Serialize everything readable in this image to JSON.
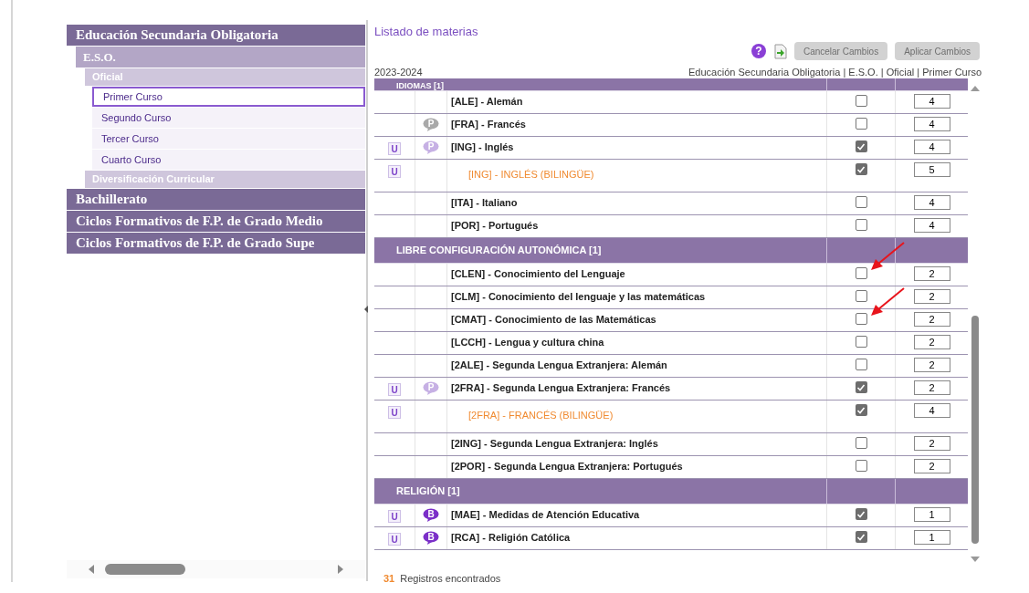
{
  "sidebar": {
    "items": [
      {
        "label": "Educación Secundaria Obligatoria",
        "children": [
          {
            "label": "E.S.O.",
            "children": [
              {
                "label": "Oficial",
                "children": [
                  {
                    "label": "Primer Curso",
                    "selected": true
                  },
                  {
                    "label": "Segundo Curso",
                    "selected": false
                  },
                  {
                    "label": "Tercer Curso",
                    "selected": false
                  },
                  {
                    "label": "Cuarto Curso",
                    "selected": false
                  }
                ]
              },
              {
                "label": "Diversificación Curricular"
              }
            ]
          }
        ]
      },
      {
        "label": "Bachillerato"
      },
      {
        "label": "Ciclos Formativos de F.P. de Grado Medio"
      },
      {
        "label": "Ciclos Formativos de F.P. de Grado Supe"
      }
    ]
  },
  "panel": {
    "title": "Listado de materias",
    "help": "?",
    "buttons": [
      {
        "label": "Cancelar Cambios",
        "disabled": true
      },
      {
        "label": "Aplicar Cambios",
        "disabled": true
      }
    ],
    "year": "2023-2024",
    "breadcrumb": "Educación Secundaria Obligatoria | E.S.O. | Oficial | Primer Curso"
  },
  "table": {
    "rows": [
      {
        "kind": "header",
        "label": "IDIOMAS [1]",
        "partial": true
      },
      {
        "kind": "subject",
        "label": "[ALE] - Alemán",
        "bilingual": false,
        "checked": false,
        "hours": "4"
      },
      {
        "kind": "subject",
        "badge": {
          "letter": "P",
          "color": "#a9a9a9"
        },
        "label": "[FRA] - Francés",
        "bilingual": false,
        "checked": false,
        "hours": "4"
      },
      {
        "kind": "subject",
        "tag": "U",
        "badge": {
          "letter": "P",
          "color": "#c6b0e4"
        },
        "label": "[ING] - Inglés",
        "bilingual": false,
        "checked": true,
        "hours": "4"
      },
      {
        "kind": "subject",
        "tag": "U",
        "label": "[ING] - INGLÉS (BILINGÜE)",
        "bilingual": true,
        "checked": true,
        "hours": "5"
      },
      {
        "kind": "subject",
        "label": "[ITA] - Italiano",
        "bilingual": false,
        "checked": false,
        "hours": "4"
      },
      {
        "kind": "subject",
        "label": "[POR] - Portugués",
        "bilingual": false,
        "checked": false,
        "hours": "4"
      },
      {
        "kind": "header",
        "label": "LIBRE CONFIGURACIÓN AUTONÓMICA [1]",
        "partial": false
      },
      {
        "kind": "subject",
        "label": "[CLEN] - Conocimiento del Lenguaje",
        "bilingual": false,
        "checked": false,
        "hours": "2",
        "arrow": true
      },
      {
        "kind": "subject",
        "label": "[CLM] - Conocimiento del lenguaje y las matemáticas",
        "bilingual": false,
        "checked": false,
        "hours": "2"
      },
      {
        "kind": "subject",
        "label": "[CMAT] - Conocimiento de las Matemáticas",
        "bilingual": false,
        "checked": false,
        "hours": "2",
        "arrow": true
      },
      {
        "kind": "subject",
        "label": "[LCCH] - Lengua y cultura china",
        "bilingual": false,
        "checked": false,
        "hours": "2"
      },
      {
        "kind": "subject",
        "label": "[2ALE] - Segunda Lengua Extranjera: Alemán",
        "bilingual": false,
        "checked": false,
        "hours": "2"
      },
      {
        "kind": "subject",
        "tag": "U",
        "badge": {
          "letter": "P",
          "color": "#c6b0e4"
        },
        "label": "[2FRA] - Segunda Lengua Extranjera: Francés",
        "bilingual": false,
        "checked": true,
        "hours": "2"
      },
      {
        "kind": "subject",
        "tag": "U",
        "label": "[2FRA] - FRANCÉS (BILINGÜE)",
        "bilingual": true,
        "checked": true,
        "hours": "4"
      },
      {
        "kind": "subject",
        "label": "[2ING] - Segunda Lengua Extranjera: Inglés",
        "bilingual": false,
        "checked": false,
        "hours": "2"
      },
      {
        "kind": "subject",
        "label": "[2POR] - Segunda Lengua Extranjera: Portugués",
        "bilingual": false,
        "checked": false,
        "hours": "2"
      },
      {
        "kind": "header",
        "label": "RELIGIÓN [1]",
        "partial": false
      },
      {
        "kind": "subject",
        "tag": "U",
        "badge": {
          "letter": "B",
          "color": "#7b2fc8"
        },
        "label": "[MAE] - Medidas de Atención Educativa",
        "bilingual": false,
        "checked": true,
        "hours": "1"
      },
      {
        "kind": "subject",
        "tag": "U",
        "badge": {
          "letter": "B",
          "color": "#7b2fc8"
        },
        "label": "[RCA] - Religión Católica",
        "bilingual": false,
        "checked": true,
        "hours": "1"
      }
    ]
  },
  "footer": {
    "count": "31",
    "text": "Registros encontrados"
  }
}
